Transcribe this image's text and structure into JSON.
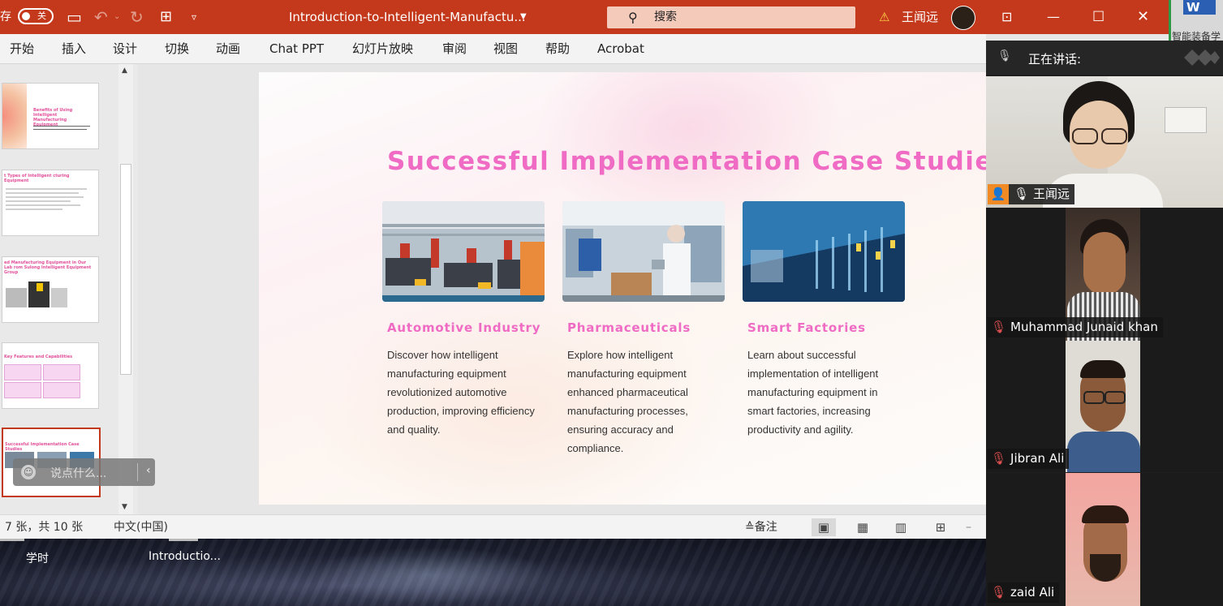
{
  "titlebar": {
    "autosave_prefix": "存",
    "autosave_toggle": "关",
    "document_title": "Introduction-to-Intelligent-Manufactu...",
    "search_placeholder": "搜索",
    "user_name": "王闻远",
    "warning_icon": "⚠"
  },
  "word_strip": {
    "app": "W",
    "text": "智能装备学"
  },
  "ribbon": {
    "tabs": [
      "开始",
      "插入",
      "设计",
      "切换",
      "动画",
      "Chat PPT",
      "幻灯片放映",
      "审阅",
      "视图",
      "帮助",
      "Acrobat"
    ]
  },
  "thumbnails": [
    {
      "title": "Benefits of Using Intelligent Manufacturing Equipment"
    },
    {
      "title": "t Types of Intelligent cturing Equipment"
    },
    {
      "title": "ed Manufacturing Equipment in Our Lab rom Sulong Intelligent Equipment Group"
    },
    {
      "title": "Key Features and Capabilities"
    },
    {
      "title": "Successful Implementation Case Studies"
    }
  ],
  "chat": {
    "placeholder": "说点什么..."
  },
  "slide": {
    "title": "Successful Implementation Case Studies",
    "cases": [
      {
        "heading": "Automotive Industry",
        "body": "Discover how intelligent manufacturing equipment revolutionized automotive production, improving efficiency and quality."
      },
      {
        "heading": "Pharmaceuticals",
        "body": "Explore how intelligent manufacturing equipment enhanced pharmaceutical manufacturing processes, ensuring accuracy and compliance."
      },
      {
        "heading": "Smart Factories",
        "body": "Learn about successful implementation of intelligent manufacturing equipment in smart factories, increasing productivity and agility."
      }
    ]
  },
  "statusbar": {
    "slide_count": "7 张，共 10 张",
    "language": "中文(中国)",
    "notes": "≙备注"
  },
  "taskbar": {
    "item1": "学时",
    "item2": "Introductio..."
  },
  "meeting": {
    "speaking_label": "正在讲话:",
    "participants": [
      "王闻远",
      "Muhammad Junaid khan",
      "Jibran Ali",
      "zaid Ali"
    ]
  }
}
